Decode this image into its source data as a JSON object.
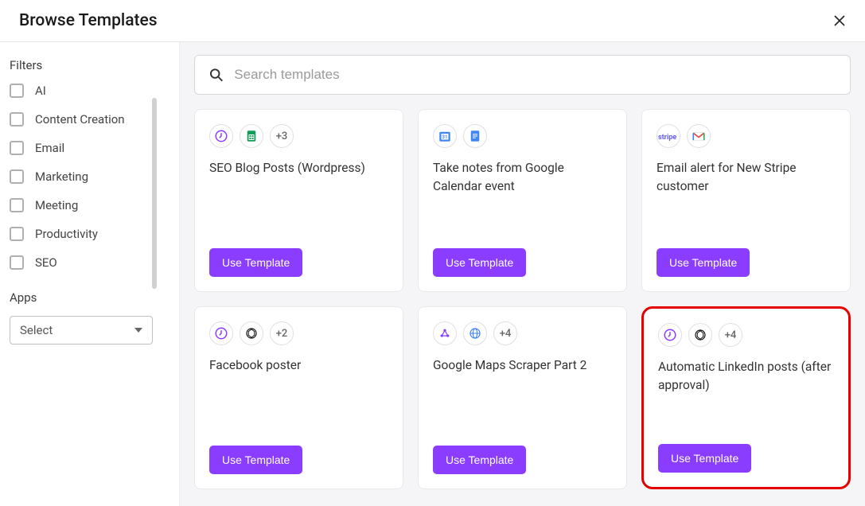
{
  "header": {
    "title": "Browse Templates"
  },
  "sidebar": {
    "filters_label": "Filters",
    "filters": [
      {
        "label": "AI"
      },
      {
        "label": "Content Creation"
      },
      {
        "label": "Email"
      },
      {
        "label": "Marketing"
      },
      {
        "label": "Meeting"
      },
      {
        "label": "Productivity"
      },
      {
        "label": "SEO"
      }
    ],
    "apps_label": "Apps",
    "select_placeholder": "Select"
  },
  "search": {
    "placeholder": "Search templates"
  },
  "colors": {
    "accent": "#8b3dff",
    "highlight": "#e60000"
  },
  "use_template_label": "Use Template",
  "templates": [
    {
      "title": "SEO Blog Posts (Wordpress)",
      "icons": [
        "schedule-icon",
        "sheets-icon"
      ],
      "more": "+3",
      "highlighted": false
    },
    {
      "title": "Take notes from Google Calendar event",
      "icons": [
        "gcal-icon",
        "gdocs-icon"
      ],
      "more": null,
      "highlighted": false
    },
    {
      "title": "Email alert for New Stripe customer",
      "icons": [
        "stripe-icon",
        "gmail-icon"
      ],
      "more": null,
      "highlighted": false
    },
    {
      "title": "Facebook poster",
      "icons": [
        "schedule-icon",
        "openai-icon"
      ],
      "more": "+2",
      "highlighted": false
    },
    {
      "title": "Google Maps Scraper Part 2",
      "icons": [
        "webhook-icon",
        "globe-icon"
      ],
      "more": "+4",
      "highlighted": false
    },
    {
      "title": "Automatic LinkedIn posts (after approval)",
      "icons": [
        "schedule-icon",
        "openai-icon"
      ],
      "more": "+4",
      "highlighted": true
    }
  ]
}
